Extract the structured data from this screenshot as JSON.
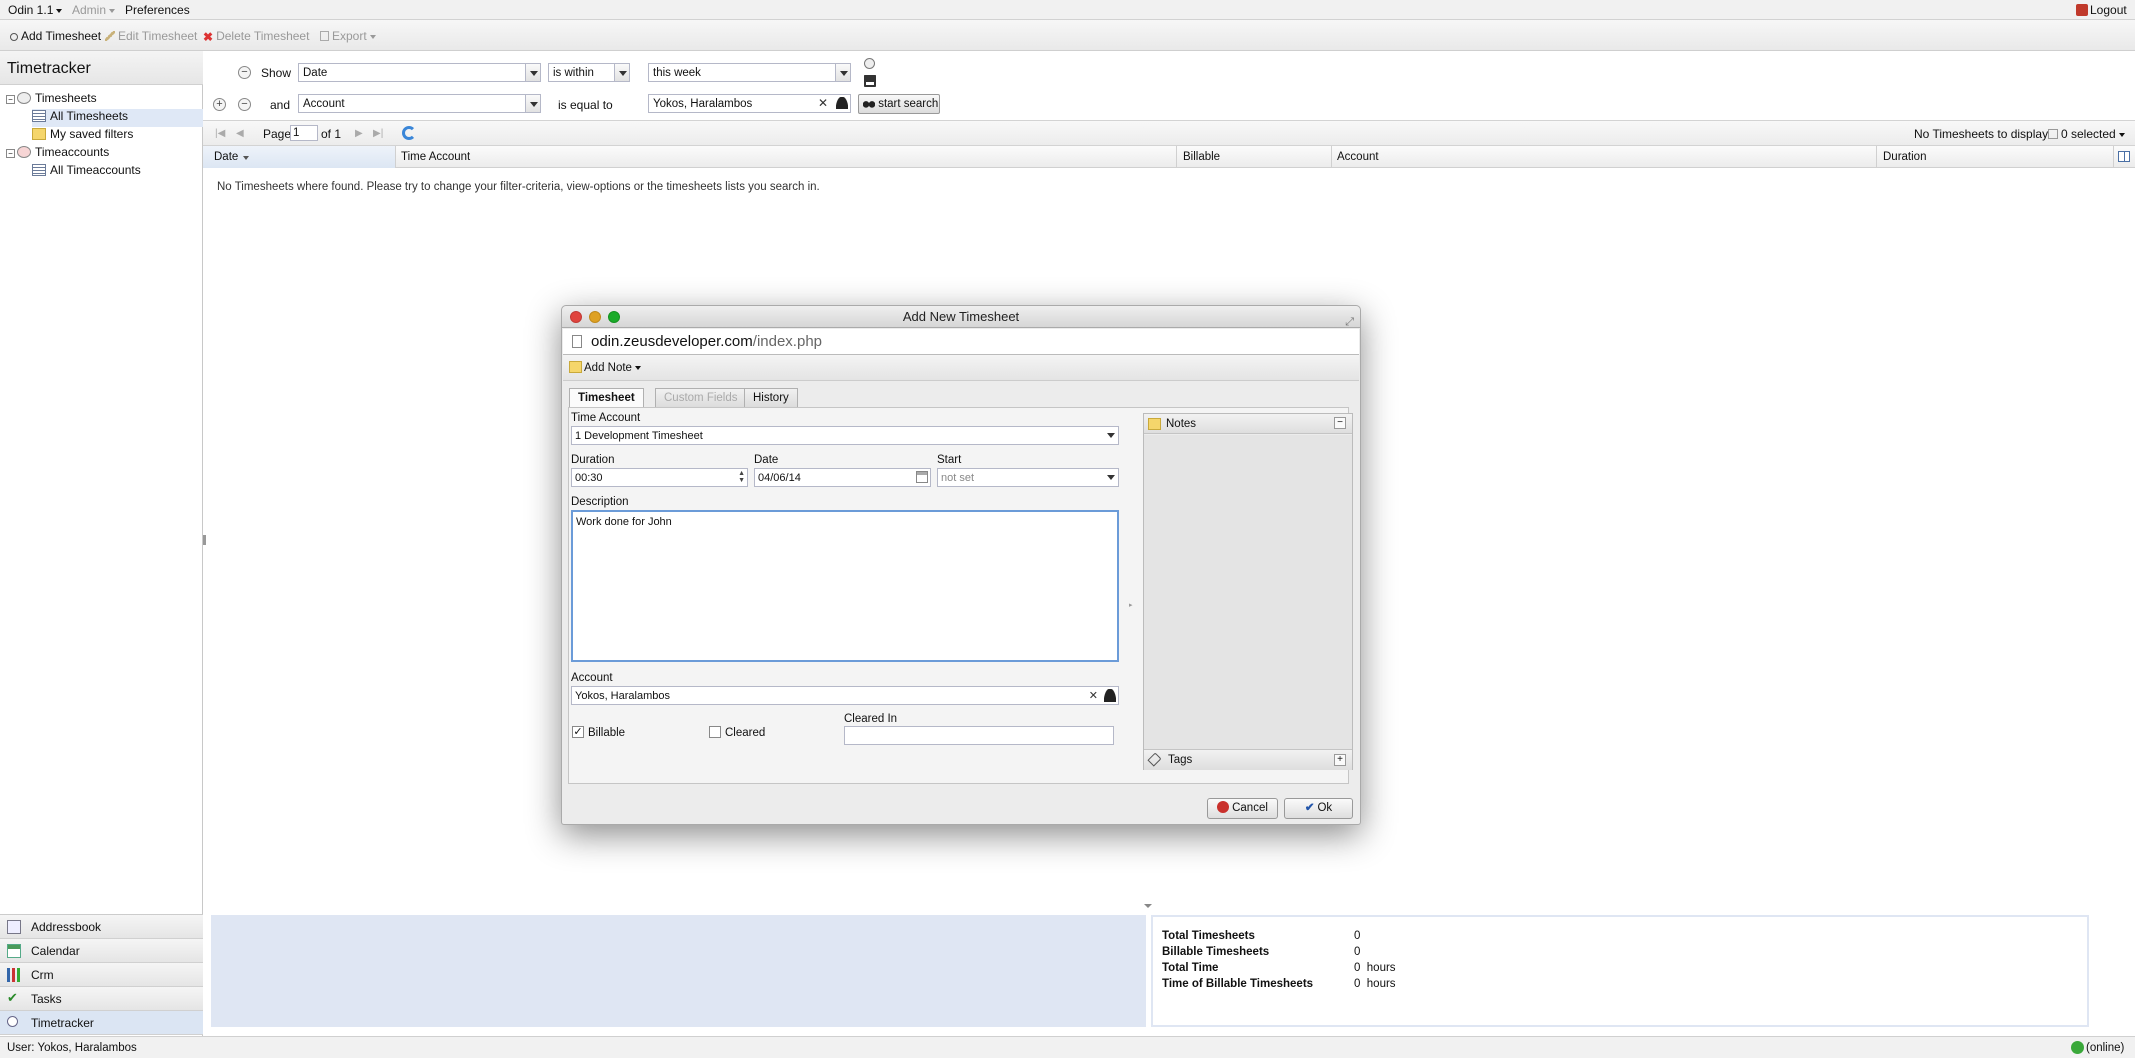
{
  "topmenu": {
    "app": "Odin 1.1",
    "admin": "Admin",
    "preferences": "Preferences",
    "logout": "Logout"
  },
  "toolbar": {
    "add": "Add Timesheet",
    "edit": "Edit Timesheet",
    "delete": "Delete Timesheet",
    "export": "Export"
  },
  "sidebar": {
    "title": "Timetracker",
    "tree": {
      "timesheets": "Timesheets",
      "all_timesheets": "All Timesheets",
      "saved_filters": "My saved filters",
      "timeaccounts": "Timeaccounts",
      "all_timeaccounts": "All Timeaccounts"
    },
    "modules": [
      "Addressbook",
      "Calendar",
      "Crm",
      "Tasks",
      "Timetracker"
    ]
  },
  "filter": {
    "row1": {
      "label": "Show",
      "field": "Date",
      "operator": "is within",
      "value": "this week"
    },
    "row2": {
      "label": "and",
      "field": "Account",
      "operator": "is equal to",
      "value": "Yokos, Haralambos"
    },
    "start_search": "start search"
  },
  "pager": {
    "page_label": "Page",
    "page": "1",
    "of": "of 1",
    "status": "No Timesheets to display",
    "selected": "0 selected"
  },
  "grid": {
    "columns": [
      "Date",
      "Time Account",
      "Billable",
      "Account",
      "Duration"
    ],
    "empty_message": "No Timesheets where found. Please try to change your filter-criteria, view-options or the timesheets lists you search in."
  },
  "summary": {
    "rows": [
      {
        "label": "Total Timesheets",
        "value": "0"
      },
      {
        "label": "Billable Timesheets",
        "value": "0"
      },
      {
        "label": "Total Time",
        "value": "0  hours"
      },
      {
        "label": "Time of Billable Timesheets",
        "value": "0  hours"
      }
    ]
  },
  "status": {
    "user": "User: Yokos, Haralambos",
    "online": "(online)"
  },
  "dialog": {
    "title": "Add New Timesheet",
    "url_domain": "odin.zeusdeveloper.com",
    "url_path": "/index.php",
    "add_note": "Add Note",
    "tabs": [
      "Timesheet",
      "Custom Fields",
      "History"
    ],
    "labels": {
      "time_account": "Time Account",
      "duration": "Duration",
      "date": "Date",
      "start": "Start",
      "description": "Description",
      "account": "Account",
      "cleared_in": "Cleared In",
      "billable": "Billable",
      "cleared": "Cleared"
    },
    "values": {
      "time_account": "1 Development Timesheet",
      "duration": "00:30",
      "date": "04/06/14",
      "start": "not set",
      "description": "Work done for John",
      "account": "Yokos, Haralambos",
      "cleared_in": ""
    },
    "billable_checked": true,
    "cleared_checked": false,
    "notes_title": "Notes",
    "tags_title": "Tags",
    "cancel": "Cancel",
    "ok": "Ok"
  }
}
